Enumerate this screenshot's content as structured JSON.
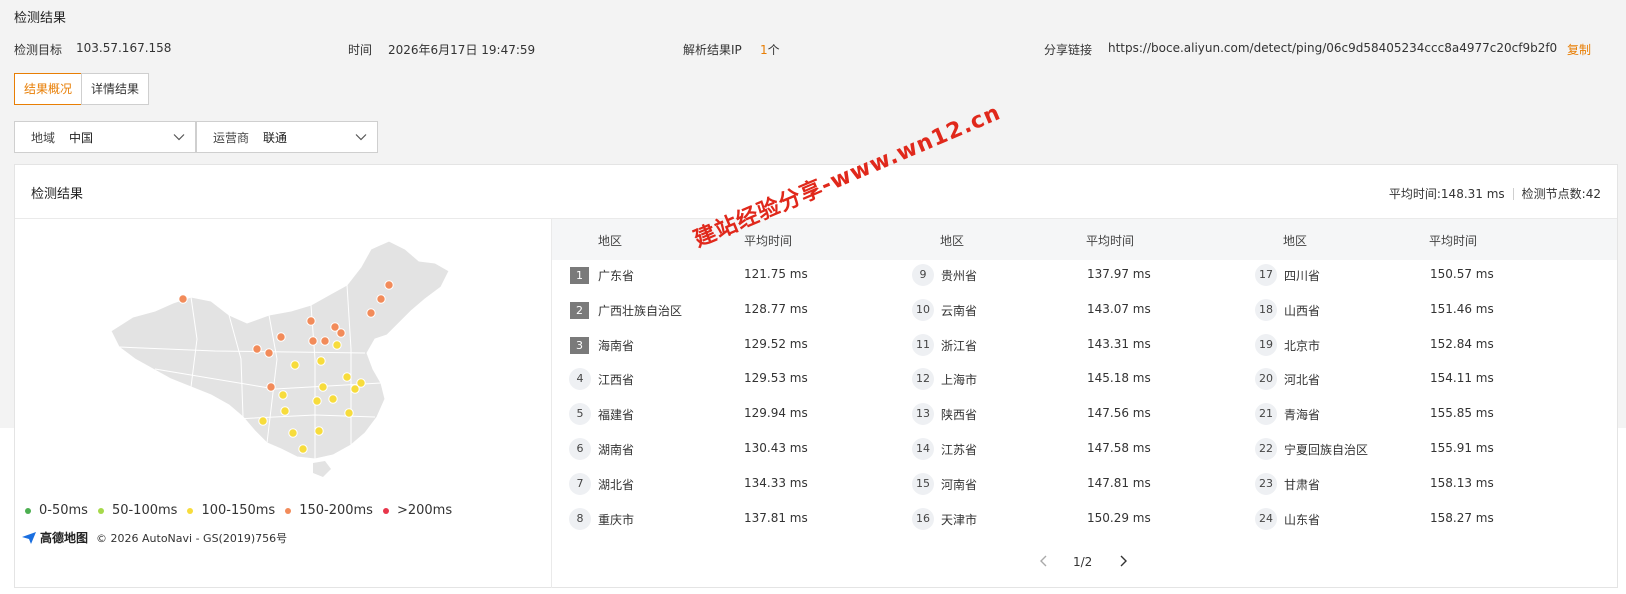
{
  "header": {
    "title": "检测结果",
    "target_label": "检测目标",
    "target_value": "103.57.167.158",
    "time_label": "时间",
    "time_value": "2026年6月17日 19:47:59",
    "ip_label": "解析结果IP",
    "ip_count": "1",
    "ip_unit": "个",
    "share_label": "分享链接",
    "share_url": "https://boce.aliyun.com/detect/ping/06c9d58405234ccc8a4977c20cf9b2f0",
    "copy_label": "复制"
  },
  "tabs": [
    {
      "label": "结果概况",
      "active": true
    },
    {
      "label": "详情结果",
      "active": false
    }
  ],
  "filters": {
    "region_label": "地域",
    "region_value": "中国",
    "isp_label": "运营商",
    "isp_value": "联通"
  },
  "card": {
    "title": "检测结果",
    "avg_time": "平均时间:148.31 ms",
    "node_count": "检测节点数:42"
  },
  "table": {
    "col_region": "地区",
    "col_avg": "平均时间",
    "rows": [
      {
        "rank": "1",
        "region": "广东省",
        "time": "121.75 ms"
      },
      {
        "rank": "2",
        "region": "广西壮族自治区",
        "time": "128.77 ms"
      },
      {
        "rank": "3",
        "region": "海南省",
        "time": "129.52 ms"
      },
      {
        "rank": "4",
        "region": "江西省",
        "time": "129.53 ms"
      },
      {
        "rank": "5",
        "region": "福建省",
        "time": "129.94 ms"
      },
      {
        "rank": "6",
        "region": "湖南省",
        "time": "130.43 ms"
      },
      {
        "rank": "7",
        "region": "湖北省",
        "time": "134.33 ms"
      },
      {
        "rank": "8",
        "region": "重庆市",
        "time": "137.81 ms"
      },
      {
        "rank": "9",
        "region": "贵州省",
        "time": "137.97 ms"
      },
      {
        "rank": "10",
        "region": "云南省",
        "time": "143.07 ms"
      },
      {
        "rank": "11",
        "region": "浙江省",
        "time": "143.31 ms"
      },
      {
        "rank": "12",
        "region": "上海市",
        "time": "145.18 ms"
      },
      {
        "rank": "13",
        "region": "陕西省",
        "time": "147.56 ms"
      },
      {
        "rank": "14",
        "region": "江苏省",
        "time": "147.58 ms"
      },
      {
        "rank": "15",
        "region": "河南省",
        "time": "147.81 ms"
      },
      {
        "rank": "16",
        "region": "天津市",
        "time": "150.29 ms"
      },
      {
        "rank": "17",
        "region": "四川省",
        "time": "150.57 ms"
      },
      {
        "rank": "18",
        "region": "山西省",
        "time": "151.46 ms"
      },
      {
        "rank": "19",
        "region": "北京市",
        "time": "152.84 ms"
      },
      {
        "rank": "20",
        "region": "河北省",
        "time": "154.11 ms"
      },
      {
        "rank": "21",
        "region": "青海省",
        "time": "155.85 ms"
      },
      {
        "rank": "22",
        "region": "宁夏回族自治区",
        "time": "155.91 ms"
      },
      {
        "rank": "23",
        "region": "甘肃省",
        "time": "158.13 ms"
      },
      {
        "rank": "24",
        "region": "山东省",
        "time": "158.27 ms"
      }
    ],
    "page": "1/2"
  },
  "legend": [
    {
      "label": "0-50ms",
      "color": "#4caf50"
    },
    {
      "label": "50-100ms",
      "color": "#a6d94a"
    },
    {
      "label": "100-150ms",
      "color": "#f7dc3c"
    },
    {
      "label": "150-200ms",
      "color": "#f28b5a"
    },
    {
      "label": ">200ms",
      "color": "#e8364b"
    }
  ],
  "map": {
    "logo_text": "高德地图",
    "copyright": "© 2026 AutoNavi - GS(2019)756号"
  },
  "watermark": "建站经验分享-www.wn12.cn",
  "colors": {
    "accent": "#e87e04",
    "map_fill": "#e3e3e3",
    "dot_yellow": "#f7dc3c",
    "dot_orange": "#f28b5a"
  }
}
